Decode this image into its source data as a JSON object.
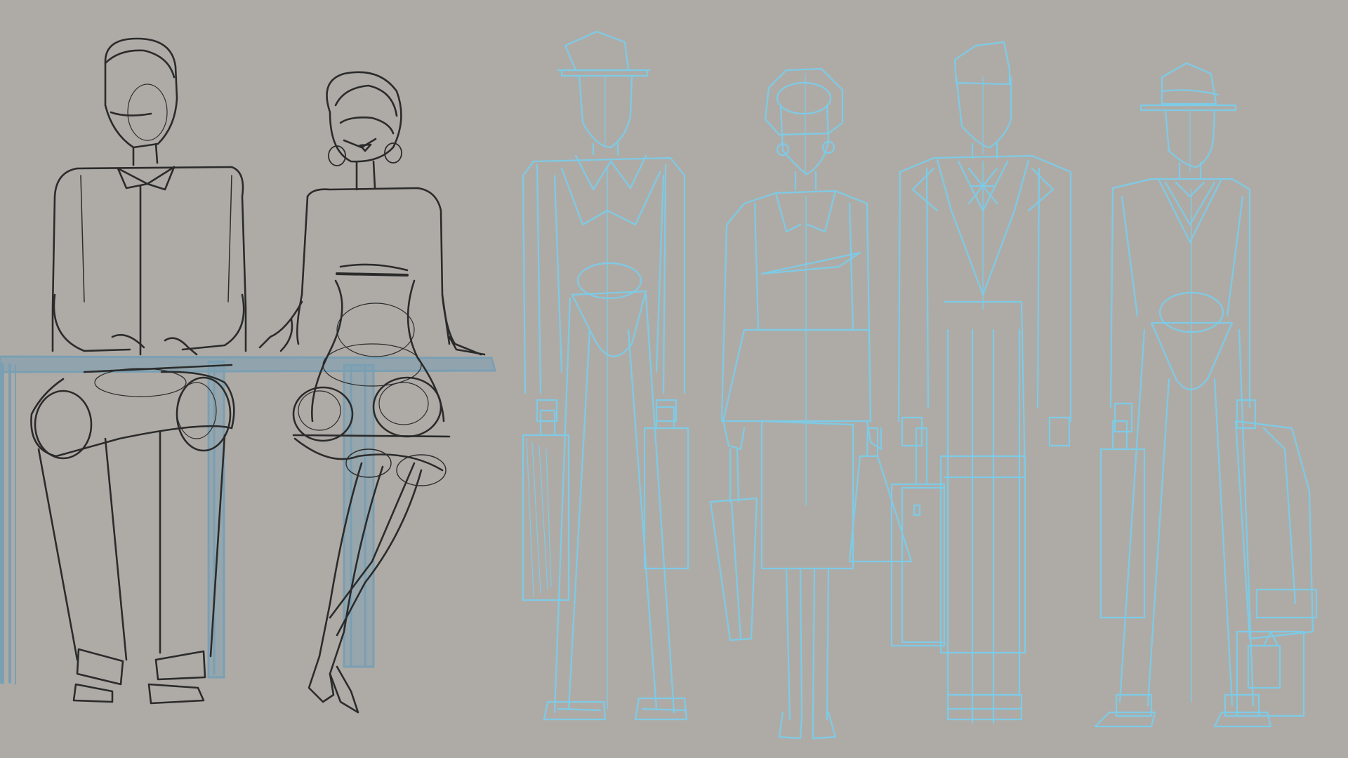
{
  "canvas": {
    "background": "#aeaba7",
    "ink_color": "#2b2b2b",
    "construction_color": "#7dcbe6",
    "bench_color": "#7a9fb3"
  },
  "figures": [
    {
      "name": "seated-man",
      "style": "inked-sketch"
    },
    {
      "name": "seated-woman",
      "style": "inked-sketch"
    },
    {
      "name": "standing-man-hat-briefcase",
      "style": "blue-construction"
    },
    {
      "name": "standing-woman-handbag-umbrella",
      "style": "blue-construction"
    },
    {
      "name": "standing-man-suit-luggage",
      "style": "blue-construction"
    },
    {
      "name": "standing-man-hat-coat-luggage",
      "style": "blue-construction"
    }
  ]
}
